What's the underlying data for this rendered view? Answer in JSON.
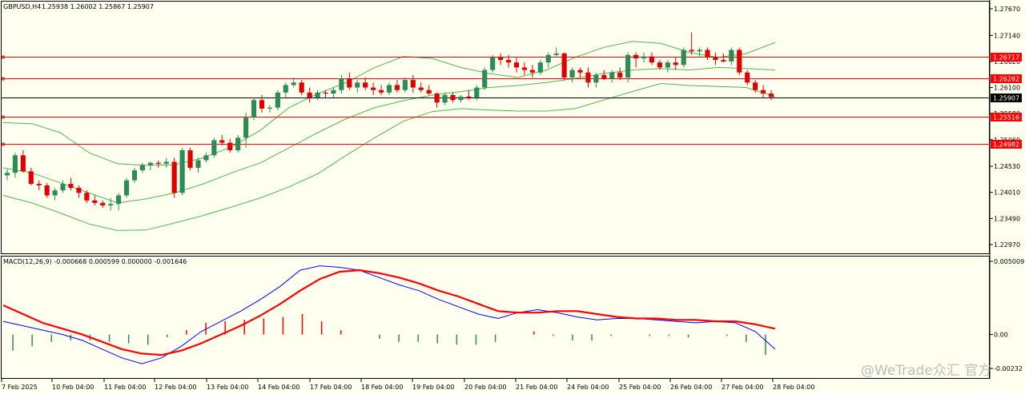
{
  "header": {
    "symbol_tf": "GBPUSD,H4",
    "ohlc": "1.25938 1.26002 1.25867 1.25907"
  },
  "macd_header": "MACD(12,26,9) -0.000668 0.000599 0.000000 -0.001646",
  "watermark": "@WeTrade众汇 官方",
  "colors": {
    "background": "#fffff0",
    "bull": "#2e8b57",
    "bear": "#e00000",
    "bands": "#4db84d",
    "macd_main": "#0000ff",
    "macd_signal": "#ff0000",
    "hline": "#ff0000"
  },
  "chart_data": [
    {
      "type": "candlestick",
      "symbol": "GBPUSD",
      "timeframe": "H4",
      "ylim": [
        1.2297,
        1.2767
      ],
      "y_ticks": [
        "1.27670",
        "1.27140",
        "1.26620",
        "1.26100",
        "1.25580",
        "1.25060",
        "1.24530",
        "1.24010",
        "1.23490",
        "1.22970"
      ],
      "x_ticks": [
        "7 Feb 2025",
        "10 Feb 04:00",
        "11 Feb 04:00",
        "12 Feb 04:00",
        "13 Feb 04:00",
        "14 Feb 04:00",
        "17 Feb 04:00",
        "18 Feb 04:00",
        "19 Feb 04:00",
        "20 Feb 04:00",
        "21 Feb 04:00",
        "24 Feb 04:00",
        "25 Feb 04:00",
        "26 Feb 04:00",
        "27 Feb 04:00",
        "28 Feb 04:00"
      ],
      "current_price": "1.25907",
      "horizontal_levels": [
        {
          "label": "1.26717",
          "value": 1.26717
        },
        {
          "label": "1.26282",
          "value": 1.26282
        },
        {
          "label": "1.25516",
          "value": 1.25516
        },
        {
          "label": "1.24982",
          "value": 1.24982
        }
      ],
      "bollinger": {
        "upper": [
          1.254,
          1.2538,
          1.252,
          1.248,
          1.2458,
          1.2455,
          1.2456,
          1.247,
          1.2492,
          1.2525,
          1.257,
          1.2598,
          1.262,
          1.265,
          1.2672,
          1.2668,
          1.265,
          1.2638,
          1.263,
          1.2645,
          1.267,
          1.269,
          1.2702,
          1.2698,
          1.268,
          1.267,
          1.2678,
          1.27
        ],
        "middle": [
          1.245,
          1.244,
          1.242,
          1.24,
          1.238,
          1.2388,
          1.24,
          1.2418,
          1.244,
          1.246,
          1.249,
          1.252,
          1.2548,
          1.257,
          1.2584,
          1.2595,
          1.2602,
          1.261,
          1.2614,
          1.262,
          1.2628,
          1.2638,
          1.2645,
          1.2648,
          1.2645,
          1.265,
          1.2648,
          1.2645
        ],
        "lower": [
          1.2395,
          1.238,
          1.236,
          1.2338,
          1.2325,
          1.2326,
          1.234,
          1.2355,
          1.2372,
          1.239,
          1.2412,
          1.2438,
          1.2475,
          1.251,
          1.2543,
          1.2562,
          1.2568,
          1.2565,
          1.2563,
          1.2563,
          1.2568,
          1.2585,
          1.2602,
          1.2618,
          1.2614,
          1.2612,
          1.261,
          1.2592
        ]
      },
      "candles": [
        [
          1.2435,
          1.2447,
          1.2425,
          1.244
        ],
        [
          1.244,
          1.248,
          1.243,
          1.2475
        ],
        [
          1.2475,
          1.2485,
          1.244,
          1.2443
        ],
        [
          1.2443,
          1.245,
          1.2415,
          1.2418
        ],
        [
          1.2418,
          1.2425,
          1.2405,
          1.2415
        ],
        [
          1.2415,
          1.242,
          1.239,
          1.2395
        ],
        [
          1.2395,
          1.241,
          1.2385,
          1.2405
        ],
        [
          1.2405,
          1.2425,
          1.24,
          1.2418
        ],
        [
          1.2418,
          1.243,
          1.2405,
          1.241
        ],
        [
          1.241,
          1.2415,
          1.239,
          1.24
        ],
        [
          1.24,
          1.2405,
          1.238,
          1.2385
        ],
        [
          1.2385,
          1.2395,
          1.2375,
          1.238
        ],
        [
          1.238,
          1.2385,
          1.237,
          1.2375
        ],
        [
          1.2375,
          1.239,
          1.2365,
          1.2378
        ],
        [
          1.2378,
          1.24,
          1.2365,
          1.2395
        ],
        [
          1.2395,
          1.243,
          1.239,
          1.2425
        ],
        [
          1.2425,
          1.245,
          1.242,
          1.2445
        ],
        [
          1.2445,
          1.246,
          1.244,
          1.2455
        ],
        [
          1.2455,
          1.2462,
          1.2445,
          1.246
        ],
        [
          1.246,
          1.2465,
          1.245,
          1.2458
        ],
        [
          1.2458,
          1.247,
          1.245,
          1.2462
        ],
        [
          1.2462,
          1.247,
          1.239,
          1.24
        ],
        [
          1.24,
          1.249,
          1.2395,
          1.2485
        ],
        [
          1.2485,
          1.249,
          1.2445,
          1.245
        ],
        [
          1.245,
          1.247,
          1.244,
          1.2465
        ],
        [
          1.2465,
          1.248,
          1.246,
          1.2475
        ],
        [
          1.2475,
          1.251,
          1.247,
          1.2505
        ],
        [
          1.2505,
          1.2515,
          1.2495,
          1.25
        ],
        [
          1.25,
          1.2508,
          1.248,
          1.2485
        ],
        [
          1.2485,
          1.2515,
          1.248,
          1.251
        ],
        [
          1.251,
          1.256,
          1.249,
          1.255
        ],
        [
          1.255,
          1.259,
          1.2545,
          1.2585
        ],
        [
          1.2585,
          1.2595,
          1.256,
          1.2568
        ],
        [
          1.2568,
          1.2575,
          1.256,
          1.257
        ],
        [
          1.257,
          1.2605,
          1.2565,
          1.26
        ],
        [
          1.26,
          1.262,
          1.259,
          1.2615
        ],
        [
          1.2615,
          1.263,
          1.261,
          1.262
        ],
        [
          1.262,
          1.2625,
          1.2595,
          1.26
        ],
        [
          1.26,
          1.261,
          1.258,
          1.259
        ],
        [
          1.259,
          1.2605,
          1.2585,
          1.26
        ],
        [
          1.26,
          1.2605,
          1.259,
          1.2598
        ],
        [
          1.2598,
          1.261,
          1.259,
          1.2605
        ],
        [
          1.2605,
          1.2635,
          1.2598,
          1.2628
        ],
        [
          1.2628,
          1.264,
          1.2605,
          1.261
        ],
        [
          1.261,
          1.2625,
          1.26,
          1.262
        ],
        [
          1.262,
          1.263,
          1.2605,
          1.261
        ],
        [
          1.261,
          1.262,
          1.2595,
          1.2605
        ],
        [
          1.2605,
          1.2615,
          1.2595,
          1.26
        ],
        [
          1.26,
          1.262,
          1.2595,
          1.2615
        ],
        [
          1.2615,
          1.2625,
          1.26,
          1.2605
        ],
        [
          1.2605,
          1.263,
          1.26,
          1.2625
        ],
        [
          1.2625,
          1.2635,
          1.26,
          1.261
        ],
        [
          1.261,
          1.262,
          1.26,
          1.2605
        ],
        [
          1.2605,
          1.2615,
          1.2595,
          1.2598
        ],
        [
          1.2598,
          1.26,
          1.257,
          1.258
        ],
        [
          1.258,
          1.26,
          1.2575,
          1.2595
        ],
        [
          1.2595,
          1.26,
          1.258,
          1.2585
        ],
        [
          1.2585,
          1.2595,
          1.258,
          1.2592
        ],
        [
          1.2592,
          1.2605,
          1.2585,
          1.259
        ],
        [
          1.259,
          1.2615,
          1.2585,
          1.261
        ],
        [
          1.261,
          1.265,
          1.2605,
          1.2645
        ],
        [
          1.2645,
          1.2675,
          1.264,
          1.267
        ],
        [
          1.267,
          1.2678,
          1.2655,
          1.2665
        ],
        [
          1.2665,
          1.2675,
          1.265,
          1.266
        ],
        [
          1.266,
          1.267,
          1.264,
          1.265
        ],
        [
          1.265,
          1.266,
          1.2635,
          1.2645
        ],
        [
          1.2645,
          1.2655,
          1.263,
          1.264
        ],
        [
          1.264,
          1.2665,
          1.2635,
          1.266
        ],
        [
          1.266,
          1.268,
          1.265,
          1.2675
        ],
        [
          1.2675,
          1.269,
          1.267,
          1.2678
        ],
        [
          1.2678,
          1.268,
          1.2625,
          1.263
        ],
        [
          1.263,
          1.265,
          1.262,
          1.2645
        ],
        [
          1.2645,
          1.265,
          1.263,
          1.264
        ],
        [
          1.264,
          1.265,
          1.261,
          1.262
        ],
        [
          1.262,
          1.264,
          1.261,
          1.2635
        ],
        [
          1.2635,
          1.2645,
          1.2625,
          1.2628
        ],
        [
          1.2628,
          1.2645,
          1.262,
          1.264
        ],
        [
          1.264,
          1.265,
          1.2625,
          1.263
        ],
        [
          1.263,
          1.268,
          1.262,
          1.2675
        ],
        [
          1.2675,
          1.268,
          1.265,
          1.2668
        ],
        [
          1.2668,
          1.268,
          1.266,
          1.2672
        ],
        [
          1.2672,
          1.268,
          1.2655,
          1.266
        ],
        [
          1.266,
          1.2665,
          1.2645,
          1.265
        ],
        [
          1.265,
          1.2665,
          1.264,
          1.266
        ],
        [
          1.266,
          1.267,
          1.2645,
          1.2655
        ],
        [
          1.2655,
          1.269,
          1.265,
          1.2685
        ],
        [
          1.2685,
          1.272,
          1.2675,
          1.2682
        ],
        [
          1.2682,
          1.269,
          1.267,
          1.2685
        ],
        [
          1.2685,
          1.269,
          1.2665,
          1.267
        ],
        [
          1.267,
          1.268,
          1.2655,
          1.2665
        ],
        [
          1.2665,
          1.2678,
          1.266,
          1.2662
        ],
        [
          1.2662,
          1.269,
          1.2655,
          1.2685
        ],
        [
          1.2685,
          1.269,
          1.2635,
          1.264
        ],
        [
          1.264,
          1.2645,
          1.2615,
          1.262
        ],
        [
          1.262,
          1.2625,
          1.26,
          1.2605
        ],
        [
          1.2605,
          1.2615,
          1.259,
          1.2598
        ],
        [
          1.2598,
          1.2605,
          1.2585,
          1.2591
        ]
      ]
    },
    {
      "type": "macd",
      "title": "MACD(12,26,9)",
      "ylim": [
        -0.00232,
        0.005009
      ],
      "y_ticks": [
        "0.005009",
        "0.00",
        "-0.00232"
      ],
      "main": [
        0.0009,
        0.0006,
        0.0003,
        0.0,
        -0.0004,
        -0.001,
        -0.0016,
        -0.002,
        -0.0016,
        -0.0008,
        0.0002,
        0.0009,
        0.0016,
        0.0024,
        0.0033,
        0.0044,
        0.0047,
        0.0046,
        0.0044,
        0.0039,
        0.0034,
        0.003,
        0.0024,
        0.0019,
        0.0014,
        0.0011,
        0.0015,
        0.0017,
        0.0015,
        0.0012,
        0.001,
        0.0011,
        0.0011,
        0.001,
        0.0009,
        0.0008,
        0.0009,
        0.0008,
        0.0002,
        -0.001
      ],
      "signal": [
        0.002,
        0.0014,
        0.0008,
        0.0004,
        0.0,
        -0.0005,
        -0.001,
        -0.0013,
        -0.0014,
        -0.0011,
        -0.0006,
        0.0,
        0.0006,
        0.0013,
        0.0021,
        0.003,
        0.0038,
        0.0043,
        0.0044,
        0.0042,
        0.0039,
        0.0035,
        0.003,
        0.0026,
        0.0021,
        0.0016,
        0.0015,
        0.0015,
        0.0016,
        0.0016,
        0.0014,
        0.0012,
        0.0011,
        0.0011,
        0.001,
        0.001,
        0.0009,
        0.0009,
        0.0007,
        0.0004
      ],
      "histogram": [
        -0.0011,
        -0.0008,
        -0.0005,
        -0.0004,
        -0.0004,
        -0.0005,
        -0.0006,
        -0.0007,
        -0.0002,
        0.0003,
        0.0008,
        0.0009,
        0.001,
        0.0011,
        0.0012,
        0.0014,
        0.0009,
        0.0003,
        0.0,
        -0.0003,
        -0.0005,
        -0.0005,
        -0.0006,
        -0.0007,
        -0.0007,
        -0.0005,
        0.0,
        0.0002,
        -0.0001,
        -0.0004,
        -0.0004,
        -0.0001,
        0.0,
        -0.0001,
        -0.0001,
        -0.0002,
        0.0,
        -0.0001,
        -0.0005,
        -0.0014
      ]
    }
  ]
}
